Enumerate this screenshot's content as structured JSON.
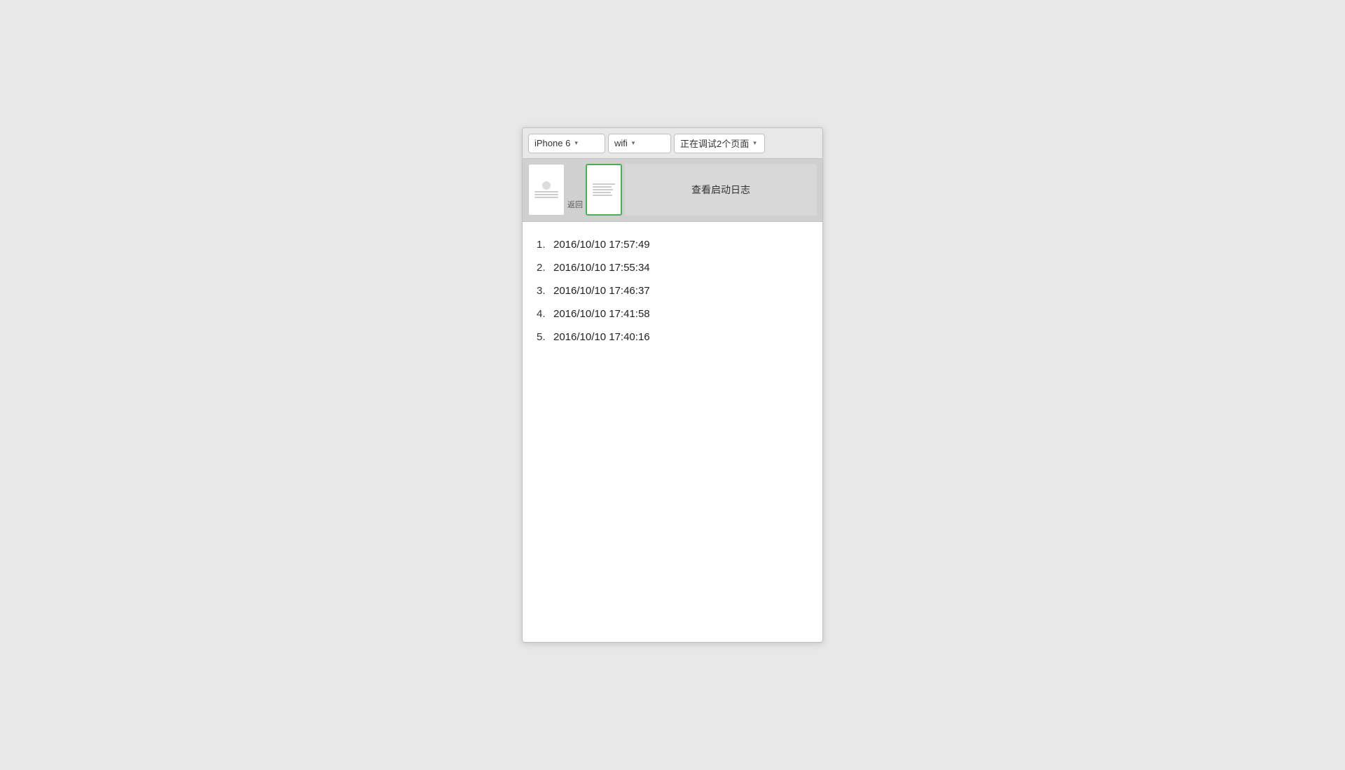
{
  "toolbar": {
    "device_label": "iPhone 6",
    "device_chevron": "▾",
    "wifi_label": "wifi",
    "wifi_chevron": "▾",
    "status_label": "正在调试2个页面",
    "status_chevron": "▾"
  },
  "pages": {
    "tab1_label": "返回",
    "tab2_label": "",
    "header_label": "查看启动日志"
  },
  "log_entries": [
    {
      "number": "1.",
      "timestamp": "2016/10/10 17:57:49"
    },
    {
      "number": "2.",
      "timestamp": "2016/10/10 17:55:34"
    },
    {
      "number": "3.",
      "timestamp": "2016/10/10 17:46:37"
    },
    {
      "number": "4.",
      "timestamp": "2016/10/10 17:41:58"
    },
    {
      "number": "5.",
      "timestamp": "2016/10/10 17:40:16"
    }
  ]
}
